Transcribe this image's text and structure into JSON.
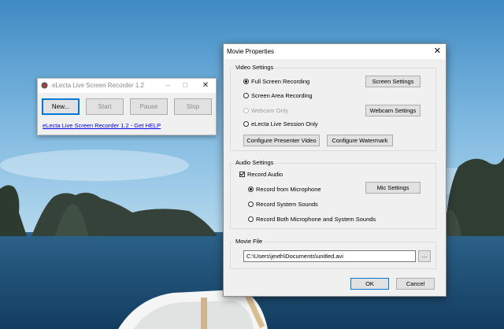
{
  "colors": {
    "sky_top": "#4a93c9",
    "sea": "#1d4f74",
    "accent_blue": "#0078d7"
  },
  "recorder": {
    "title": "eLecta Live Screen Recorder 1.2",
    "app_icon": "recorder-app-icon",
    "buttons": {
      "new": "New...",
      "start": "Start",
      "pause": "Pause",
      "stop": "Stop"
    },
    "help_link": "eLecta Live Screen Recorder 1.2 - Get HELP"
  },
  "dialog": {
    "title": "Movie Properties",
    "close_icon": "close-icon",
    "video": {
      "label": "Video Settings",
      "options": {
        "full_screen": "Full Screen Recording",
        "screen_area": "Screen Area Recording",
        "webcam_only": "Webcam Only",
        "session_only": "eLecta Live Session Only"
      },
      "selected": "Full Screen Recording",
      "screen_settings": "Screen Settings",
      "webcam_settings": "Webcam Settings",
      "configure_presenter": "Configure Presenter Video",
      "configure_watermark": "Configure Watermark"
    },
    "audio": {
      "label": "Audio Settings",
      "record_audio": "Record Audio",
      "record_audio_checked": true,
      "options": {
        "microphone": "Record from Microphone",
        "system": "Record System Sounds",
        "both": "Record Both Microphone and System Sounds"
      },
      "selected": "Record from Microphone",
      "mic_settings": "Mic Settings"
    },
    "movie_file": {
      "label": "Movie File",
      "path": "C:\\Users\\jexth\\Documents\\unitled.avi",
      "browse": "..."
    },
    "ok": "OK",
    "cancel": "Cancel"
  }
}
